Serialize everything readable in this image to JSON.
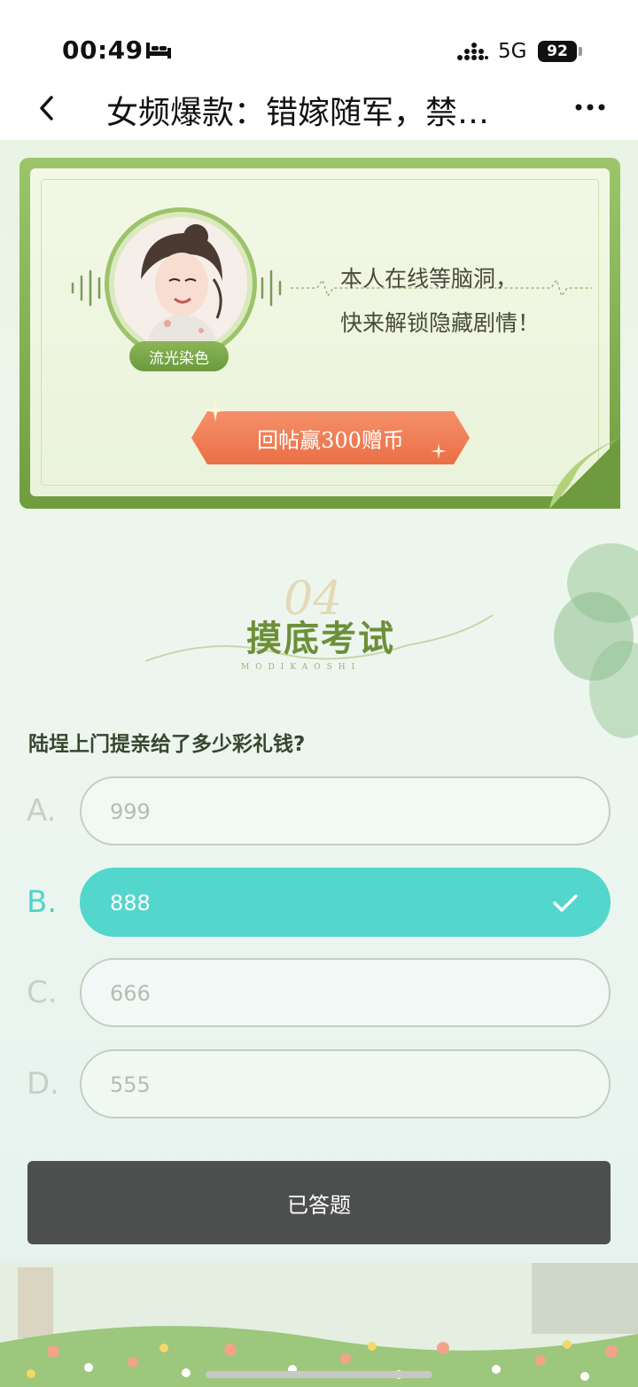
{
  "status_bar": {
    "time": "00:49",
    "network": "5G",
    "battery": "92",
    "icons": [
      "bed-icon",
      "signal-icon",
      "battery-icon"
    ]
  },
  "nav": {
    "title": "女频爆款：错嫁随军，禁…",
    "icons": [
      "back-icon",
      "more-icon"
    ]
  },
  "banner": {
    "badge": "流光染色",
    "text_line1": "本人在线等脑洞，",
    "text_line2": "快来解锁隐藏剧情！",
    "button": "回帖赢300赠币"
  },
  "section": {
    "number": "04",
    "title": "摸底考试",
    "subtitle": "MODIKAOSHI"
  },
  "quiz": {
    "question": "陆埕上门提亲给了多少彩礼钱?",
    "options": [
      {
        "letter": "A.",
        "text": "999",
        "selected": false
      },
      {
        "letter": "B.",
        "text": "888",
        "selected": true
      },
      {
        "letter": "C.",
        "text": "666",
        "selected": false
      },
      {
        "letter": "D.",
        "text": "555",
        "selected": false
      }
    ],
    "submit": "已答题"
  },
  "colors": {
    "accent_teal": "#53d6cb",
    "banner_green": "#7aa846",
    "reward_orange": "#ef7a4f",
    "submit_dark": "#4c4f4d"
  }
}
